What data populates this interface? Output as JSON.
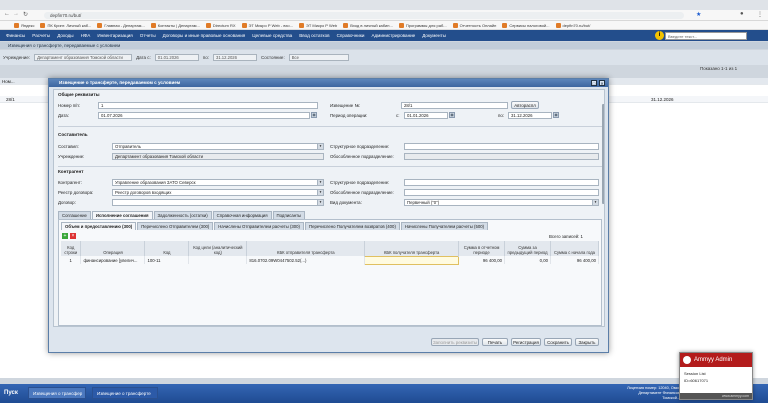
{
  "browser": {
    "url": "depfin70.ru/but/",
    "bookmarks": [
      "Яндекс",
      "ПК Крипт. Личный каб...",
      "Главная - Департам...",
      "Контакты | Департам...",
      "Directum RX",
      "ЭТ Микро Р Web - вхо...",
      "ЭТ Микро Р Web",
      "Вход в личный кабин...",
      "Программы для раб...",
      "Отчетность Онлайн",
      "Сервисы налоговой...",
      "depfin70.ru/but/"
    ]
  },
  "app_menu": {
    "items": [
      "Финансы",
      "Расчеты",
      "Доходы",
      "НФА",
      "Инвентаризация",
      "Отчеты",
      "Договоры и иные правовые основания",
      "Целевые средства",
      "Ввод остатков",
      "Справочники",
      "Администрирование",
      "Документы"
    ],
    "search_placeholder": "Введите текст...",
    "help_label": "i"
  },
  "page": {
    "subhead": "Извещения о трансферте, передаваемые с условием",
    "filter": {
      "org_label": "Учреждение:",
      "org_value": "Департамент образования Томской области",
      "date_label": "Дата с:",
      "date_from": "01.01.2026",
      "to_label": "по:",
      "date_to": "31.12.2026",
      "status_label": "Состояние:",
      "status_value": "Все"
    },
    "records": "Показано 1-1 из 1",
    "row_id": "28/1",
    "row_date": "31.12.2026",
    "col_no": "Ном..."
  },
  "dialog": {
    "title": "Извещение о трансферте, передаваемом с условием",
    "sect_general": "Общие реквизиты",
    "no_label": "Номер п/п:",
    "no_value": "1",
    "date_label": "Дата:",
    "date_value": "01.07.2026",
    "notice_label": "Извещение №:",
    "notice_value": "28/1",
    "autonum_btn": "Автораспл",
    "period_label": "Период операции:",
    "period_from_label": "с:",
    "period_from": "01.01.2026",
    "period_to_label": "по:",
    "period_to": "31.12.2026",
    "sect_composer": "Составитель",
    "composer_label": "Составил:",
    "composer_value": "Отправитель",
    "institution_label": "Учреждение:",
    "institution_value": "Департамент образования Томской области",
    "struct_label": "Структурное подразделение:",
    "separate_label": "Обособленное подразделение:",
    "sect_contractor": "Контрагент",
    "contractor_label": "Контрагент:",
    "contractor_value": "Управление образования ЗАТО Северск",
    "registry_label": "Реестр договора:",
    "registry_value": "Реестр договоров входящих",
    "contract_label": "Договор:",
    "struct2_label": "Структурное подразделение:",
    "separate2_label": "Обособленное подразделение:",
    "doctype_label": "Вид документа:",
    "doctype_value": "Первичный (\"0\")",
    "tabs_main": [
      "Соглашение",
      "Исполнение соглашения",
      "Задолженность (остатки)",
      "Справочная информация",
      "Подписанты"
    ],
    "tabs_sub": [
      "Объем и предоставлению (300)",
      "Перечислено Отправителем (300)",
      "Начислены Отправителем расчеты (300)",
      "Перечислено Получателем возвратов (400)",
      "Начислены Получателем расчеты (500)"
    ],
    "total_label": "Всего записей: 1",
    "columns": [
      "Код строки",
      "Операция",
      "Код",
      "Код цели (аналитический код)",
      "КБК отправителя трансферта",
      "КБК получателя трансферта",
      "Сумма в отчетном периоде",
      "Сумма за предыдущий период",
      "Сумма с начала года"
    ],
    "rows": [
      [
        "1",
        "финансирование [увелич...",
        "100-11",
        "",
        "816.0702.09W0447502.52(...)",
        "",
        "96 400,00",
        "0,00",
        "96 400,00"
      ]
    ],
    "footer_buttons": [
      "Заполнить реквизиты",
      "Печать",
      "Регистрация",
      "Сохранить",
      "Закрыть"
    ]
  },
  "taskbar": {
    "start": "Пуск",
    "items": [
      "Извещения о трансфер",
      "Извещение о трансферте"
    ],
    "tray_line1": "Лицензия номер: 12040, Омск",
    "tray_line2": "Департамент Финансов Томской..."
  },
  "ammyy": {
    "title": "Ammyy Admin",
    "line1": "Session List",
    "line2": "ID=60617071",
    "link": "www.ammyy.com"
  }
}
